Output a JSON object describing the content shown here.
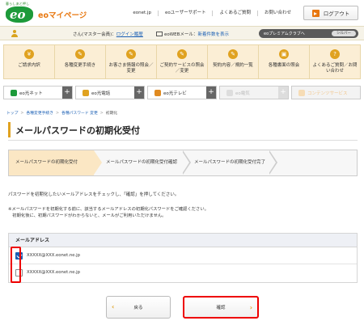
{
  "header": {
    "logo_tagline": "暮らしあと押し",
    "logo_text": "eo",
    "site_name": "eoマイページ",
    "links": [
      "eonet.jp",
      "eoユーザーサポート",
      "よくあるご質問",
      "お問い合わせ"
    ],
    "login_label": "ログアウト"
  },
  "userbar": {
    "greeting": "さん(マスター会員)：",
    "login_history": "ログイン履歴",
    "mail_label": "eoWEBメール：",
    "mail_link": "新着件数を表示",
    "premium_label": "eoプレミアムクラブへ",
    "premium_rank": "シルバー"
  },
  "menu": [
    {
      "icon": "¥",
      "label": "ご請求内訳"
    },
    {
      "icon": "✎",
      "label": "各種変更手続き"
    },
    {
      "icon": "✎",
      "label": "お客さま情報の照会／変更"
    },
    {
      "icon": "✎",
      "label": "ご契約サービスの照会／変更"
    },
    {
      "icon": "✎",
      "label": "契約内容／規約一覧"
    },
    {
      "icon": "▣",
      "label": "各種書面の照会"
    },
    {
      "icon": "?",
      "label": "よくあるご質問／お問い合わせ"
    }
  ],
  "service_tabs": [
    {
      "label": "eo光ネット",
      "color": "#1d9a3a",
      "disabled": false
    },
    {
      "label": "eo光電話",
      "color": "#e0a220",
      "disabled": false
    },
    {
      "label": "eo光テレビ",
      "color": "#e08a20",
      "disabled": false
    },
    {
      "label": "eo電気",
      "color": "#cccccc",
      "disabled": true
    },
    {
      "label": "コンテンツサービス",
      "color": "#f1c58a",
      "disabled": true
    }
  ],
  "breadcrumb": [
    "トップ",
    "各種変更手続き",
    "各種パスワード 変更",
    "初期化"
  ],
  "page_title": "メールパスワードの初期化受付",
  "steps": [
    "メールパスワードの初期化受付",
    "メールパスワードの初期化受付確認",
    "メールパスワードの初期化受付完了"
  ],
  "description": "パスワードを初期化したいメールアドレスをチェックし、「確認」を押してください。",
  "notes": [
    "※メールパスワードを初期化する前に、該当するメールアドレスの初期化パスワードをご確認ください。",
    "　初期化後に、初期パスワードがわからないと、メールがご利用いただけません。"
  ],
  "mail_table": {
    "header": "メールアドレス",
    "rows": [
      {
        "address": "XXXXX@XXX.eonet.ne.jp",
        "checked": true
      },
      {
        "address": "XXXXX@XXX.eonet.ne.jp",
        "checked": false
      }
    ]
  },
  "buttons": {
    "back": "戻る",
    "confirm": "確認"
  }
}
